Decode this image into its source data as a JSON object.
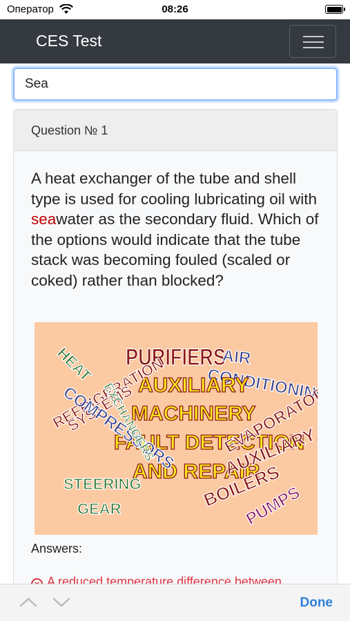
{
  "status_bar": {
    "carrier": "Оператор",
    "time": "08:26"
  },
  "navbar": {
    "brand": "CES Test",
    "menu_icon": "hamburger-icon"
  },
  "search": {
    "value": "Sea"
  },
  "card": {
    "header": "Question № 1",
    "question_before": "A heat exchanger of the tube and shell type is used for cooling lubricating oil with ",
    "question_highlight": "sea",
    "question_after": "water as the secondary fluid. Which of the options would indicate that the tube stack was becoming fouled (scaled or coked) rather than blocked?",
    "image_words": [
      "PURIFIERS",
      "AIR",
      "CONDITIONING",
      "AUXILIARY",
      "MACHINERY",
      "FAULT DETECTION",
      "AND REPAIR",
      "REFRIGERATION",
      "SYSTEMS",
      "COMPRESSORS",
      "STEERING",
      "GEAR",
      "EVAPORATORS",
      "AUXILIARY",
      "BOILERS",
      "PUMPS",
      "HEAT",
      "EXCHANGERS"
    ],
    "answers_label": "Answers:",
    "answer_1": "A reduced temperature difference between"
  },
  "keyboard_bar": {
    "done": "Done"
  },
  "colors": {
    "navbar": "#343a40",
    "accent": "#2f80d8",
    "wrong": "#dc3545",
    "highlight": "#c00000"
  }
}
